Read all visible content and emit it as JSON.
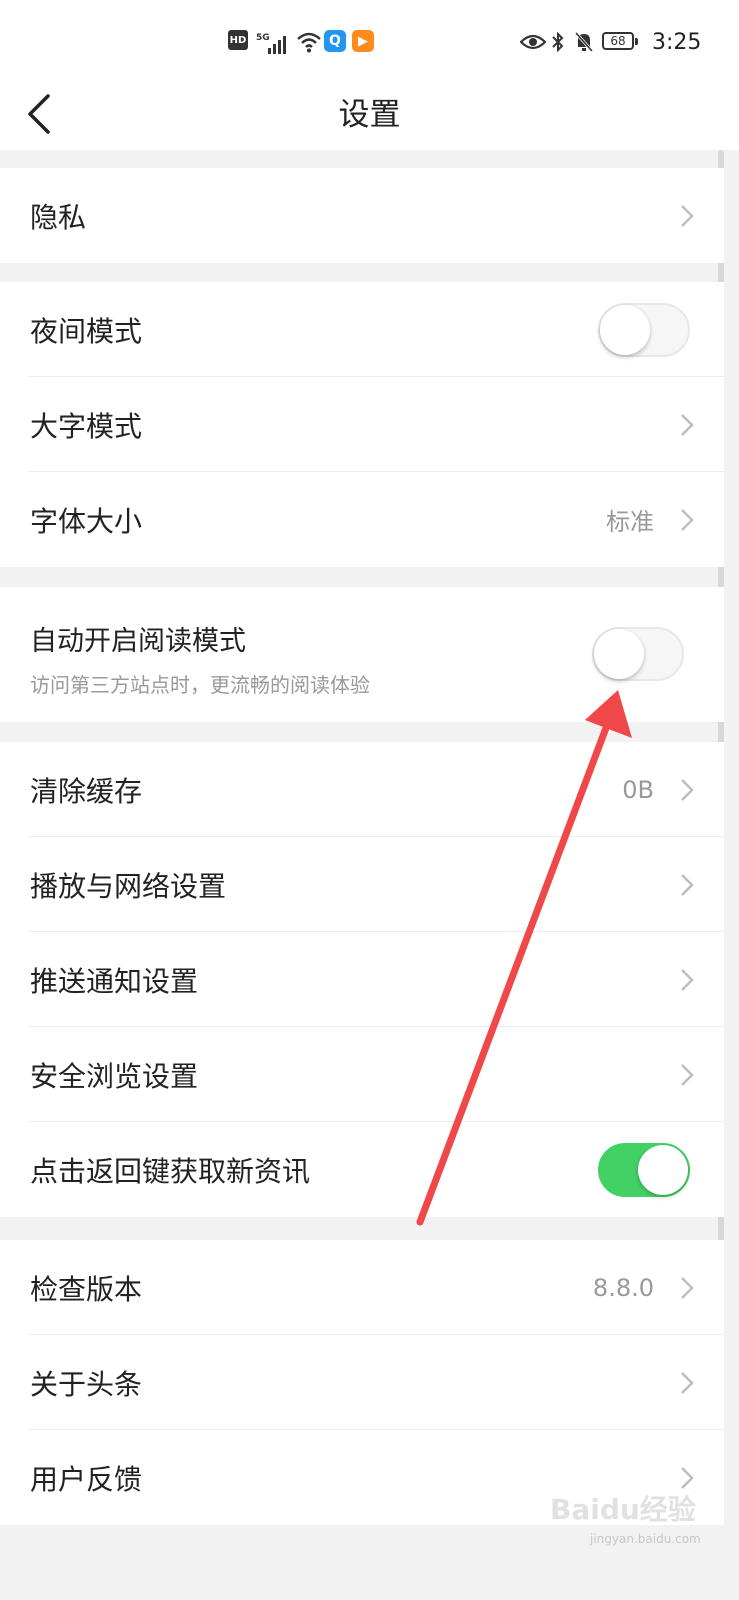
{
  "status_bar": {
    "hd": "HD",
    "network": "5G",
    "app1_icon": "Q",
    "app2_icon": "▶",
    "battery": "68",
    "time": "3:25"
  },
  "header": {
    "title": "设置"
  },
  "groups": {
    "privacy": {
      "label": "隐私"
    },
    "display": {
      "night_mode": {
        "label": "夜间模式",
        "enabled": false
      },
      "large_text": {
        "label": "大字模式"
      },
      "font_size": {
        "label": "字体大小",
        "value": "标准"
      }
    },
    "reading": {
      "auto_reader": {
        "label": "自动开启阅读模式",
        "description": "访问第三方站点时，更流畅的阅读体验",
        "enabled": false
      }
    },
    "general": {
      "clear_cache": {
        "label": "清除缓存",
        "value": "0B"
      },
      "playback_network": {
        "label": "播放与网络设置"
      },
      "push_notifications": {
        "label": "推送通知设置"
      },
      "safe_browsing": {
        "label": "安全浏览设置"
      },
      "back_refresh": {
        "label": "点击返回键获取新资讯",
        "enabled": true
      }
    },
    "about": {
      "check_version": {
        "label": "检查版本",
        "value": "8.8.0"
      },
      "about_toutiao": {
        "label": "关于头条"
      },
      "feedback": {
        "label": "用户反馈"
      }
    }
  },
  "colors": {
    "toggle_on": "#43d165",
    "annotation_arrow": "#f04848"
  },
  "watermark": {
    "brand": "Baidu经验",
    "url": "jingyan.baidu.com"
  }
}
